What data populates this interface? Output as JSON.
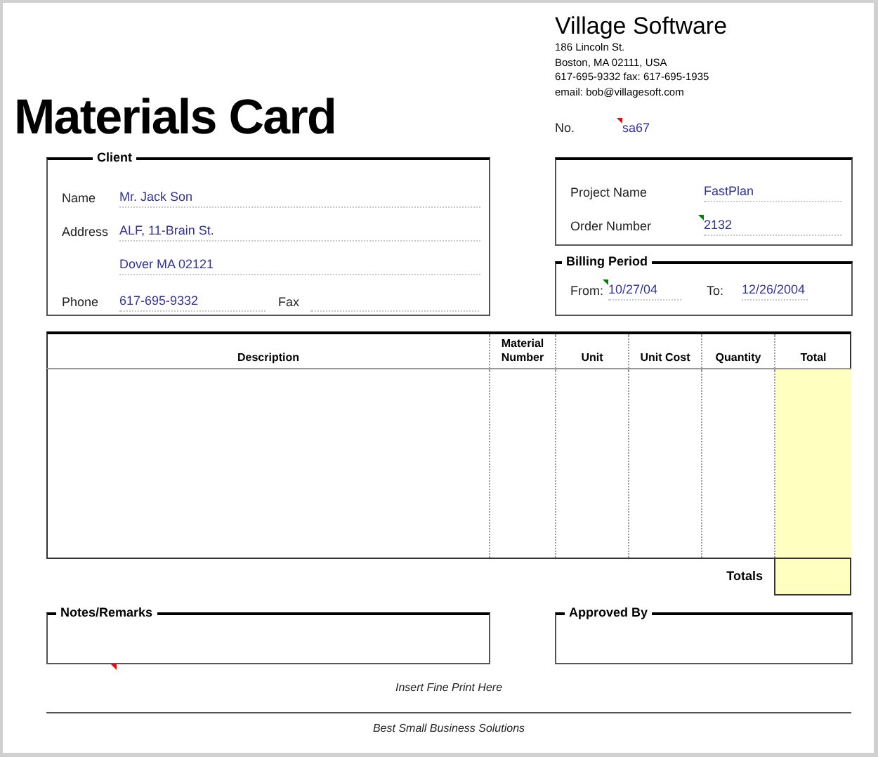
{
  "company": {
    "name": "Village Software",
    "address_lines": [
      "186 Lincoln St.",
      "Boston, MA 02111, USA",
      "617-695-9332 fax: 617-695-1935",
      "email: bob@villagesoft.com"
    ]
  },
  "title": "Materials Card",
  "number": {
    "label": "No.",
    "value": "sa67"
  },
  "client": {
    "title": "Client",
    "lines": [
      {
        "label": "Name",
        "value": "Mr. Jack Son"
      },
      {
        "label": "Address",
        "value": "ALF, 11-Brain St."
      },
      {
        "value": "Dover MA 02121"
      }
    ],
    "phone": {
      "label": "Phone",
      "value": "617-695-9332"
    },
    "fax": {
      "label": "Fax"
    }
  },
  "project": {
    "fields": [
      {
        "label": "Project Name",
        "value": "FastPlan"
      },
      {
        "label": "Order Number",
        "value": "2132"
      }
    ]
  },
  "billing": {
    "title": "Billing Period",
    "from": {
      "label": "From:",
      "value": "10/27/04"
    },
    "to": {
      "label": "To:",
      "value": "12/26/2004"
    }
  },
  "table": {
    "columns": [
      {
        "label": "Description"
      },
      {
        "label": "Material Number"
      },
      {
        "label": "Unit"
      },
      {
        "label": "Unit Cost"
      },
      {
        "label": "Quantity"
      },
      {
        "label": "Total"
      }
    ],
    "totals_label": "Totals"
  },
  "notes": {
    "title": "Notes/Remarks"
  },
  "approval": {
    "title": "Approved By"
  },
  "fine_print": "Insert Fine Print Here",
  "footer": "Best Small Business Solutions"
}
